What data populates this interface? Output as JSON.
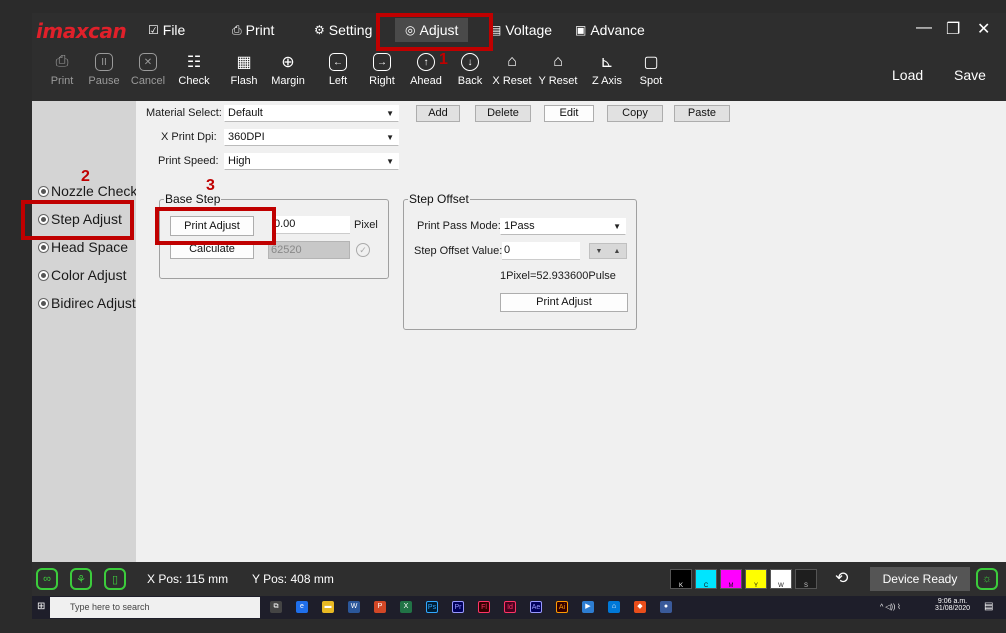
{
  "app": {
    "logo": "imaxcan",
    "menu": [
      {
        "label": "File",
        "icon": "check-square-icon"
      },
      {
        "label": "Print",
        "icon": "printer-icon"
      },
      {
        "label": "Setting",
        "icon": "gear-icon"
      },
      {
        "label": "Adjust",
        "icon": "adjust-icon"
      },
      {
        "label": "Voltage",
        "icon": "voltage-icon"
      },
      {
        "label": "Advance",
        "icon": "advance-icon"
      }
    ]
  },
  "toolbar": {
    "buttons": [
      {
        "label": "Print",
        "icon": "printer-icon",
        "enabled": false
      },
      {
        "label": "Pause",
        "icon": "pause-icon",
        "enabled": false
      },
      {
        "label": "Cancel",
        "icon": "cancel-icon",
        "enabled": false
      },
      {
        "label": "Check",
        "icon": "check-icon",
        "enabled": true
      },
      {
        "label": "Flash",
        "icon": "flash-icon",
        "enabled": true
      },
      {
        "label": "Margin",
        "icon": "target-icon",
        "enabled": true
      },
      {
        "label": "Left",
        "icon": "arrow-left-icon",
        "enabled": true
      },
      {
        "label": "Right",
        "icon": "arrow-right-icon",
        "enabled": true
      },
      {
        "label": "Ahead",
        "icon": "arrow-up-icon",
        "enabled": true
      },
      {
        "label": "Back",
        "icon": "arrow-down-icon",
        "enabled": true
      },
      {
        "label": "X Reset",
        "icon": "home-icon",
        "enabled": true
      },
      {
        "label": "Y Reset",
        "icon": "home-icon",
        "enabled": true
      },
      {
        "label": "Z Axis",
        "icon": "axis-icon",
        "enabled": true
      },
      {
        "label": "Spot",
        "icon": "spot-icon",
        "enabled": true
      }
    ],
    "load_label": "Load",
    "save_label": "Save"
  },
  "sidebar": {
    "items": [
      {
        "label": "Nozzle Check"
      },
      {
        "label": "Step Adjust"
      },
      {
        "label": "Head Space"
      },
      {
        "label": "Color Adjust"
      },
      {
        "label": "Bidirec Adjust"
      }
    ]
  },
  "settings": {
    "material_label": "Material Select:",
    "material_value": "Default",
    "add_label": "Add",
    "delete_label": "Delete",
    "edit_label": "Edit",
    "copy_label": "Copy",
    "paste_label": "Paste",
    "dpi_label": "X Print Dpi:",
    "dpi_value": "360DPI",
    "speed_label": "Print Speed:",
    "speed_value": "High"
  },
  "base_step": {
    "title": "Base Step",
    "print_adjust_label": "Print Adjust",
    "value": "0.00",
    "unit": "Pixel",
    "calculate_label": "Calculate",
    "calc_value": "62520"
  },
  "step_offset": {
    "title": "Step Offset",
    "pass_mode_label": "Print Pass Mode:",
    "pass_mode_value": "1Pass",
    "offset_label": "Step Offset Value:",
    "offset_value": "0",
    "pixel_info": "1Pixel=52.933600Pulse",
    "print_adjust_label": "Print Adjust"
  },
  "annotations": [
    "1",
    "2",
    "3"
  ],
  "status": {
    "x_pos": "X Pos: 115 mm",
    "y_pos": "Y Pos: 408 mm",
    "inks": [
      {
        "label": "K",
        "color": "#000000"
      },
      {
        "label": "C",
        "color": "#00e5ff"
      },
      {
        "label": "M",
        "color": "#ff00ff"
      },
      {
        "label": "Y",
        "color": "#ffff00"
      },
      {
        "label": "W",
        "color": "#ffffff"
      },
      {
        "label": "S",
        "color": "#1e1e1e"
      }
    ],
    "device_ready": "Device Ready"
  },
  "taskbar": {
    "search_placeholder": "Type here to search",
    "time": "9:06 a.m.",
    "date": "31/08/2020"
  }
}
